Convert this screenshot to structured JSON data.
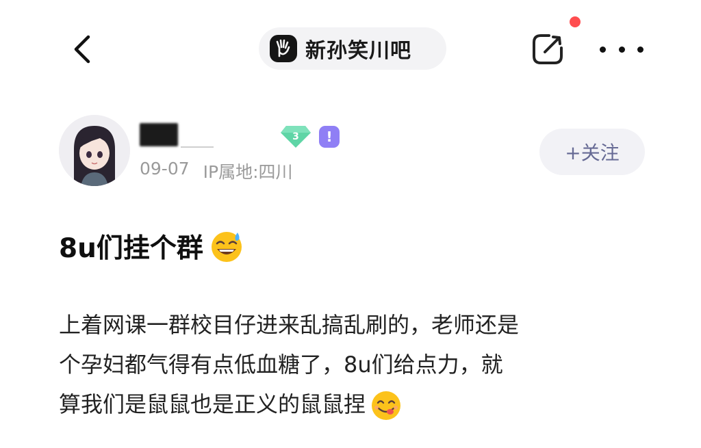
{
  "header": {
    "forum_name": "新孙笑川吧",
    "icons": {
      "back": "chevron-left-icon",
      "forum": "forum-logo-icon",
      "share": "share-icon",
      "more": "more-icon"
    },
    "notification_dot_color": "#ff4d4f"
  },
  "author": {
    "level": "3",
    "member_badge": "!",
    "date": "09-07",
    "ip_location": "IP属地:四川",
    "follow_label": "+关注"
  },
  "post": {
    "title": "8u们挂个群",
    "body_lines": [
      "上着网课一群校目仔进来乱搞乱刷的，老师还是",
      "个孕妇都气得有点低血糖了，8u们给点力，就",
      "算我们是鼠鼠也是正义的鼠鼠捏"
    ]
  },
  "colors": {
    "accent_follow_text": "#676b95",
    "meta_text": "#9a9a9a",
    "level_badge": "#5fd5a6",
    "member_badge": "#8f7ff5"
  }
}
